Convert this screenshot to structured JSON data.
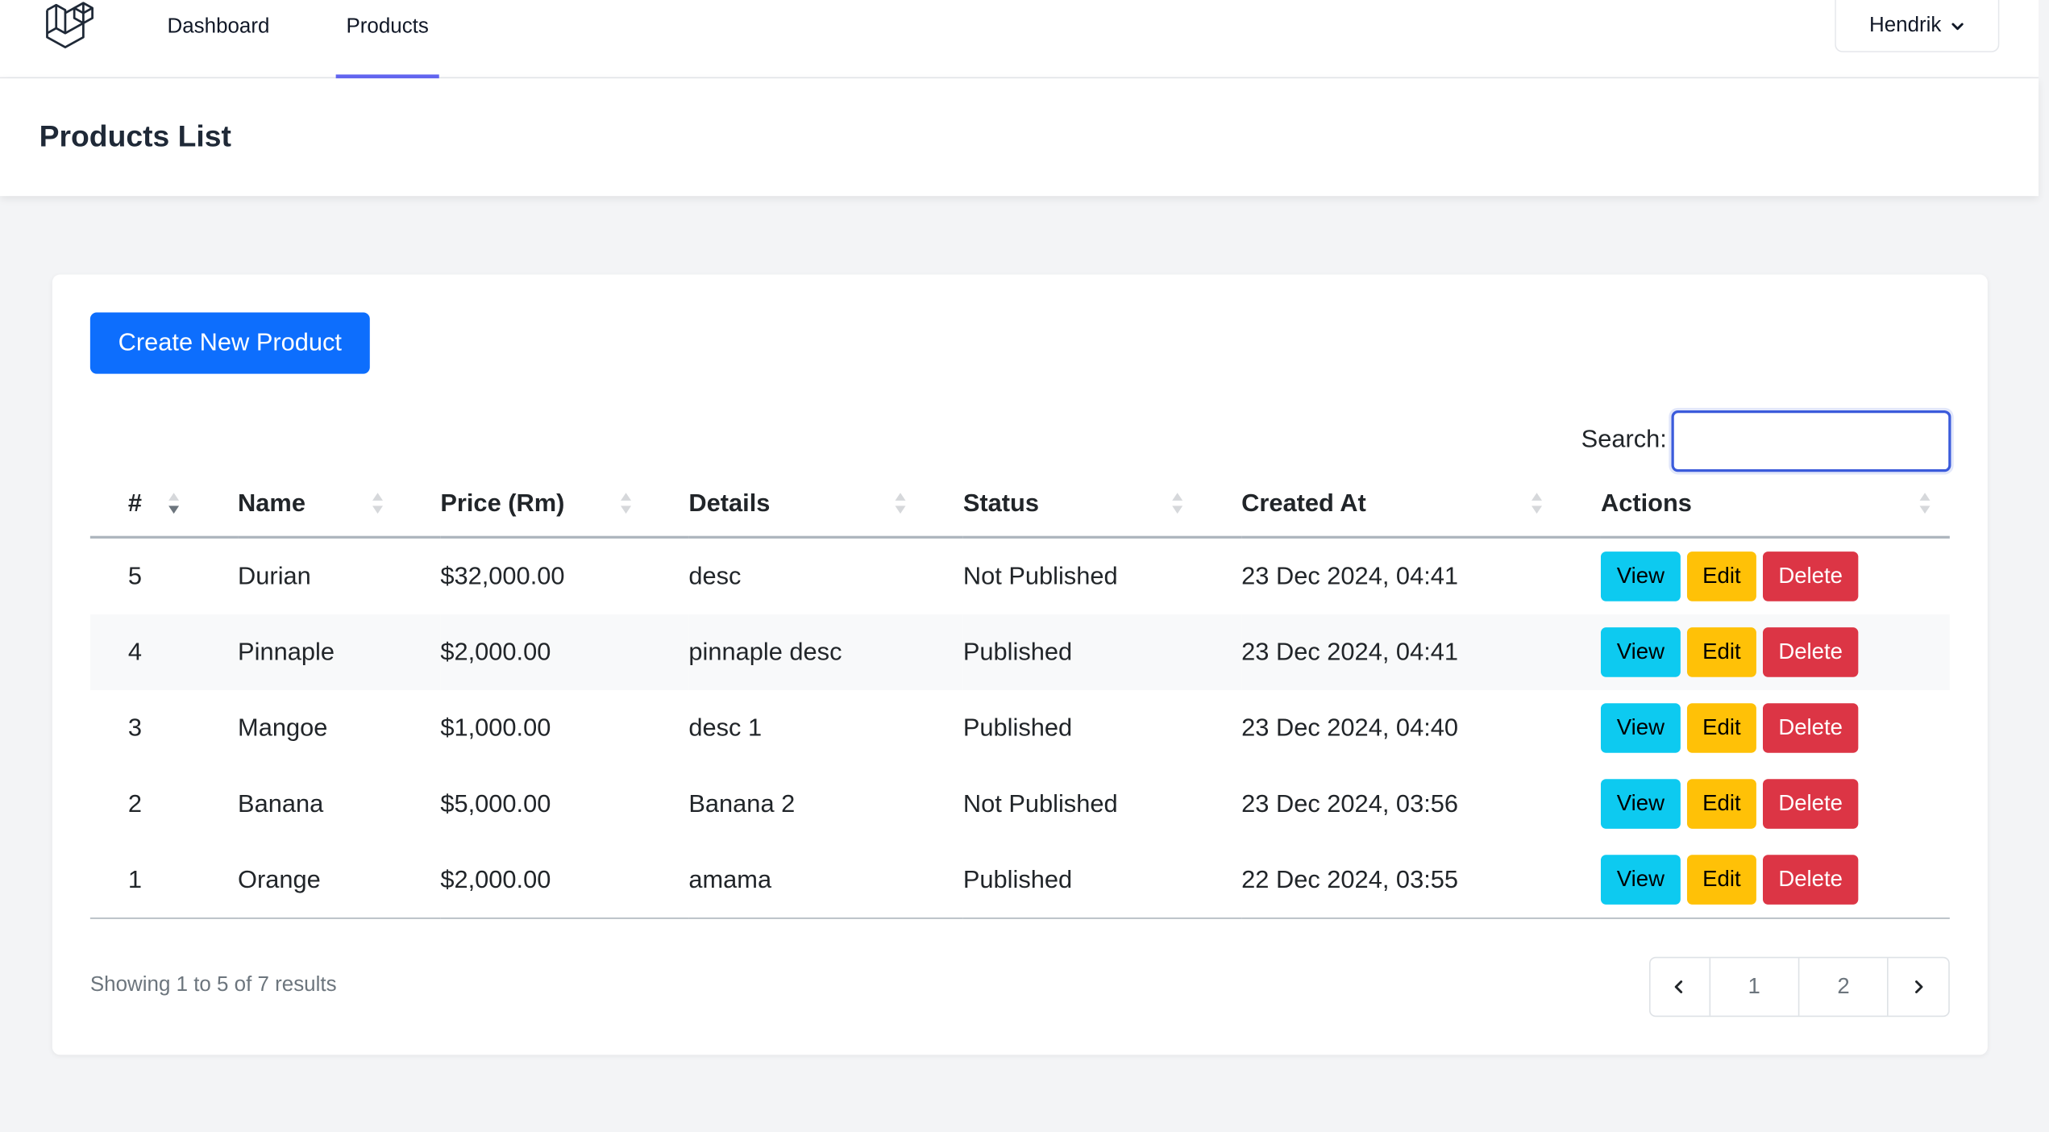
{
  "nav": {
    "links": [
      "Dashboard",
      "Products"
    ],
    "active": "Products",
    "user": "Hendrik"
  },
  "header": {
    "title": "Products List"
  },
  "toolbar": {
    "create_label": "Create New Product",
    "search_label": "Search:",
    "search_value": ""
  },
  "table": {
    "columns": [
      "#",
      "Name",
      "Price (Rm)",
      "Details",
      "Status",
      "Created At",
      "Actions"
    ],
    "sorted_column": "#",
    "sort_direction": "desc",
    "rows": [
      {
        "id": "5",
        "name": "Durian",
        "price": "$32,000.00",
        "details": "desc",
        "status": "Not Published",
        "created": "23 Dec 2024, 04:41"
      },
      {
        "id": "4",
        "name": "Pinnaple",
        "price": "$2,000.00",
        "details": "pinnaple desc",
        "status": "Published",
        "created": "23 Dec 2024, 04:41"
      },
      {
        "id": "3",
        "name": "Mangoe",
        "price": "$1,000.00",
        "details": "desc 1",
        "status": "Published",
        "created": "23 Dec 2024, 04:40"
      },
      {
        "id": "2",
        "name": "Banana",
        "price": "$5,000.00",
        "details": "Banana 2",
        "status": "Not Published",
        "created": "23 Dec 2024, 03:56"
      },
      {
        "id": "1",
        "name": "Orange",
        "price": "$2,000.00",
        "details": "amama",
        "status": "Published",
        "created": "22 Dec 2024, 03:55"
      }
    ],
    "actions": {
      "view": "View",
      "edit": "Edit",
      "delete": "Delete"
    }
  },
  "footer": {
    "info": "Showing 1 to 5 of 7 results",
    "pages": [
      "1",
      "2"
    ],
    "prev_icon": "chevron-left-icon",
    "next_icon": "chevron-right-icon"
  },
  "colors": {
    "primary": "#0d6efd",
    "info": "#0dcaf0",
    "warning": "#ffc107",
    "danger": "#dc3545",
    "nav_accent": "#6366f1"
  }
}
